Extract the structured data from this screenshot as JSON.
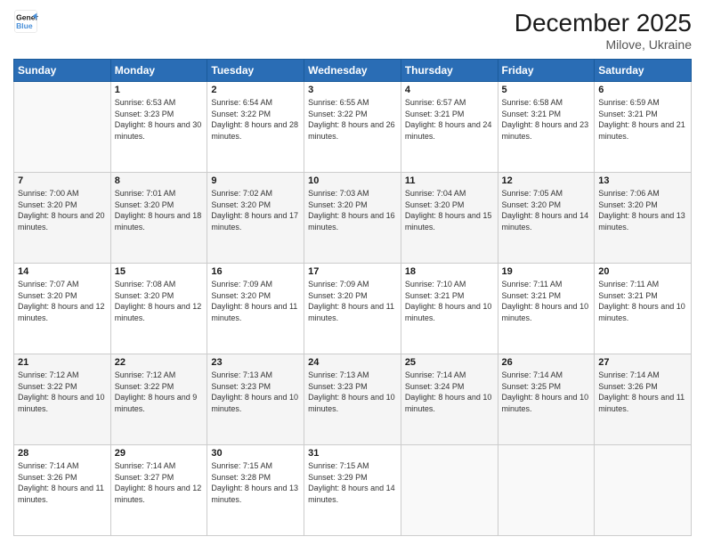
{
  "logo": {
    "line1": "General",
    "line2": "Blue"
  },
  "header": {
    "month": "December 2025",
    "location": "Milove, Ukraine"
  },
  "days_of_week": [
    "Sunday",
    "Monday",
    "Tuesday",
    "Wednesday",
    "Thursday",
    "Friday",
    "Saturday"
  ],
  "weeks": [
    [
      {
        "num": "",
        "sunrise": "",
        "sunset": "",
        "daylight": ""
      },
      {
        "num": "1",
        "sunrise": "Sunrise: 6:53 AM",
        "sunset": "Sunset: 3:23 PM",
        "daylight": "Daylight: 8 hours and 30 minutes."
      },
      {
        "num": "2",
        "sunrise": "Sunrise: 6:54 AM",
        "sunset": "Sunset: 3:22 PM",
        "daylight": "Daylight: 8 hours and 28 minutes."
      },
      {
        "num": "3",
        "sunrise": "Sunrise: 6:55 AM",
        "sunset": "Sunset: 3:22 PM",
        "daylight": "Daylight: 8 hours and 26 minutes."
      },
      {
        "num": "4",
        "sunrise": "Sunrise: 6:57 AM",
        "sunset": "Sunset: 3:21 PM",
        "daylight": "Daylight: 8 hours and 24 minutes."
      },
      {
        "num": "5",
        "sunrise": "Sunrise: 6:58 AM",
        "sunset": "Sunset: 3:21 PM",
        "daylight": "Daylight: 8 hours and 23 minutes."
      },
      {
        "num": "6",
        "sunrise": "Sunrise: 6:59 AM",
        "sunset": "Sunset: 3:21 PM",
        "daylight": "Daylight: 8 hours and 21 minutes."
      }
    ],
    [
      {
        "num": "7",
        "sunrise": "Sunrise: 7:00 AM",
        "sunset": "Sunset: 3:20 PM",
        "daylight": "Daylight: 8 hours and 20 minutes."
      },
      {
        "num": "8",
        "sunrise": "Sunrise: 7:01 AM",
        "sunset": "Sunset: 3:20 PM",
        "daylight": "Daylight: 8 hours and 18 minutes."
      },
      {
        "num": "9",
        "sunrise": "Sunrise: 7:02 AM",
        "sunset": "Sunset: 3:20 PM",
        "daylight": "Daylight: 8 hours and 17 minutes."
      },
      {
        "num": "10",
        "sunrise": "Sunrise: 7:03 AM",
        "sunset": "Sunset: 3:20 PM",
        "daylight": "Daylight: 8 hours and 16 minutes."
      },
      {
        "num": "11",
        "sunrise": "Sunrise: 7:04 AM",
        "sunset": "Sunset: 3:20 PM",
        "daylight": "Daylight: 8 hours and 15 minutes."
      },
      {
        "num": "12",
        "sunrise": "Sunrise: 7:05 AM",
        "sunset": "Sunset: 3:20 PM",
        "daylight": "Daylight: 8 hours and 14 minutes."
      },
      {
        "num": "13",
        "sunrise": "Sunrise: 7:06 AM",
        "sunset": "Sunset: 3:20 PM",
        "daylight": "Daylight: 8 hours and 13 minutes."
      }
    ],
    [
      {
        "num": "14",
        "sunrise": "Sunrise: 7:07 AM",
        "sunset": "Sunset: 3:20 PM",
        "daylight": "Daylight: 8 hours and 12 minutes."
      },
      {
        "num": "15",
        "sunrise": "Sunrise: 7:08 AM",
        "sunset": "Sunset: 3:20 PM",
        "daylight": "Daylight: 8 hours and 12 minutes."
      },
      {
        "num": "16",
        "sunrise": "Sunrise: 7:09 AM",
        "sunset": "Sunset: 3:20 PM",
        "daylight": "Daylight: 8 hours and 11 minutes."
      },
      {
        "num": "17",
        "sunrise": "Sunrise: 7:09 AM",
        "sunset": "Sunset: 3:20 PM",
        "daylight": "Daylight: 8 hours and 11 minutes."
      },
      {
        "num": "18",
        "sunrise": "Sunrise: 7:10 AM",
        "sunset": "Sunset: 3:21 PM",
        "daylight": "Daylight: 8 hours and 10 minutes."
      },
      {
        "num": "19",
        "sunrise": "Sunrise: 7:11 AM",
        "sunset": "Sunset: 3:21 PM",
        "daylight": "Daylight: 8 hours and 10 minutes."
      },
      {
        "num": "20",
        "sunrise": "Sunrise: 7:11 AM",
        "sunset": "Sunset: 3:21 PM",
        "daylight": "Daylight: 8 hours and 10 minutes."
      }
    ],
    [
      {
        "num": "21",
        "sunrise": "Sunrise: 7:12 AM",
        "sunset": "Sunset: 3:22 PM",
        "daylight": "Daylight: 8 hours and 10 minutes."
      },
      {
        "num": "22",
        "sunrise": "Sunrise: 7:12 AM",
        "sunset": "Sunset: 3:22 PM",
        "daylight": "Daylight: 8 hours and 9 minutes."
      },
      {
        "num": "23",
        "sunrise": "Sunrise: 7:13 AM",
        "sunset": "Sunset: 3:23 PM",
        "daylight": "Daylight: 8 hours and 10 minutes."
      },
      {
        "num": "24",
        "sunrise": "Sunrise: 7:13 AM",
        "sunset": "Sunset: 3:23 PM",
        "daylight": "Daylight: 8 hours and 10 minutes."
      },
      {
        "num": "25",
        "sunrise": "Sunrise: 7:14 AM",
        "sunset": "Sunset: 3:24 PM",
        "daylight": "Daylight: 8 hours and 10 minutes."
      },
      {
        "num": "26",
        "sunrise": "Sunrise: 7:14 AM",
        "sunset": "Sunset: 3:25 PM",
        "daylight": "Daylight: 8 hours and 10 minutes."
      },
      {
        "num": "27",
        "sunrise": "Sunrise: 7:14 AM",
        "sunset": "Sunset: 3:26 PM",
        "daylight": "Daylight: 8 hours and 11 minutes."
      }
    ],
    [
      {
        "num": "28",
        "sunrise": "Sunrise: 7:14 AM",
        "sunset": "Sunset: 3:26 PM",
        "daylight": "Daylight: 8 hours and 11 minutes."
      },
      {
        "num": "29",
        "sunrise": "Sunrise: 7:14 AM",
        "sunset": "Sunset: 3:27 PM",
        "daylight": "Daylight: 8 hours and 12 minutes."
      },
      {
        "num": "30",
        "sunrise": "Sunrise: 7:15 AM",
        "sunset": "Sunset: 3:28 PM",
        "daylight": "Daylight: 8 hours and 13 minutes."
      },
      {
        "num": "31",
        "sunrise": "Sunrise: 7:15 AM",
        "sunset": "Sunset: 3:29 PM",
        "daylight": "Daylight: 8 hours and 14 minutes."
      },
      {
        "num": "",
        "sunrise": "",
        "sunset": "",
        "daylight": ""
      },
      {
        "num": "",
        "sunrise": "",
        "sunset": "",
        "daylight": ""
      },
      {
        "num": "",
        "sunrise": "",
        "sunset": "",
        "daylight": ""
      }
    ]
  ]
}
